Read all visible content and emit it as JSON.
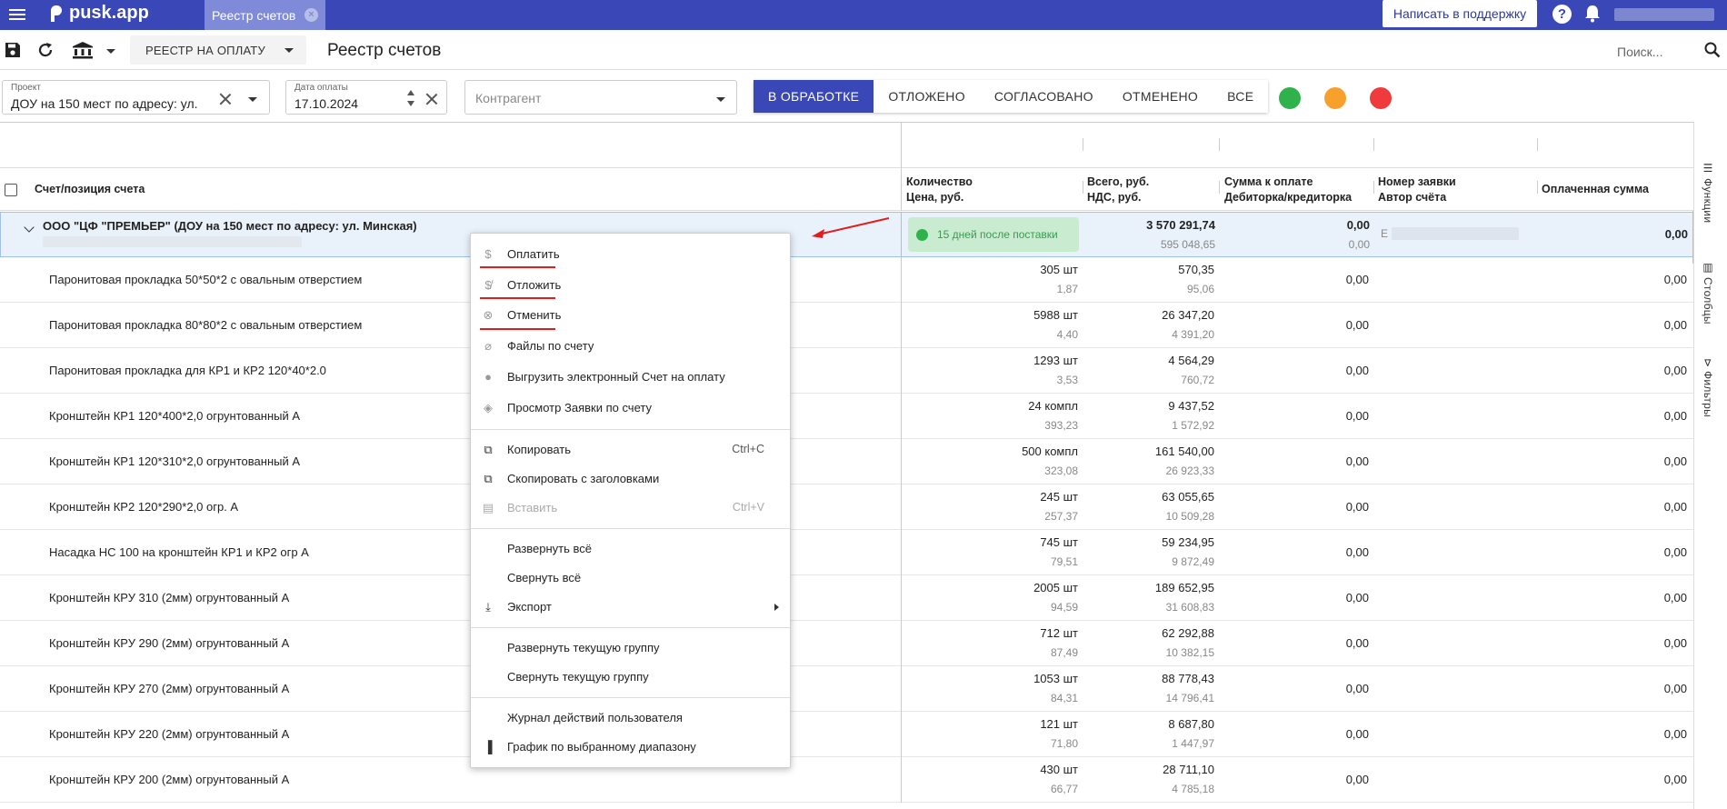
{
  "topbar": {
    "logo": "pusk.app",
    "tab_label": "Реестр счетов",
    "tab_close": "×",
    "support_label": "Написать в поддержку",
    "help_label": "?"
  },
  "toolbar": {
    "registry_label": "РЕЕСТР НА ОПЛАТУ",
    "page_title": "Реестр счетов",
    "search_label": "Поиск..."
  },
  "filters": {
    "project": {
      "label": "Проект",
      "value": "ДОУ на 150 мест по адресу: ул."
    },
    "pay_date": {
      "label": "Дата оплаты",
      "value": "17.10.2024"
    },
    "counterparty": {
      "placeholder": "Контрагент"
    },
    "status_tabs": [
      {
        "label": "В ОБРАБОТКЕ",
        "active": true
      },
      {
        "label": "ОТЛОЖЕНО",
        "active": false
      },
      {
        "label": "СОГЛАСОВАНО",
        "active": false
      },
      {
        "label": "ОТМЕНЕНО",
        "active": false
      },
      {
        "label": "ВСЕ",
        "active": false
      }
    ],
    "status_dots": [
      "#2fb24c",
      "#f7a12c",
      "#ef3b3b"
    ]
  },
  "table": {
    "headers": {
      "item": "Счет/позиция счета",
      "qty": "Количество",
      "price": "Цена, руб.",
      "total": "Всего, руб.",
      "vat": "НДС, руб.",
      "to_pay": "Сумма к оплате",
      "debt": "Дебиторка/кредиторка",
      "req_no": "Номер заявки",
      "author": "Автор счёта",
      "paid": "Оплаченная сумма"
    },
    "group": {
      "title": "ООО \"ЦФ \"ПРЕМЬЕР\" (ДОУ на 150 мест по адресу: ул. Минская)",
      "badge": "15 дней после поставки",
      "total": "3 570 291,74",
      "vat": "595 048,65",
      "to_pay": "0,00",
      "debt": "0,00",
      "req_initial": "Е",
      "paid": "0,00"
    },
    "rows": [
      {
        "name": "Паронитовая прокладка 50*50*2 с овальным отверстием",
        "qty": "305 шт",
        "price": "1,87",
        "total": "570,35",
        "vat": "95,06",
        "to_pay": "0,00",
        "paid": "0,00"
      },
      {
        "name": "Паронитовая прокладка 80*80*2 с овальным отверстием",
        "qty": "5988 шт",
        "price": "4,40",
        "total": "26 347,20",
        "vat": "4 391,20",
        "to_pay": "0,00",
        "paid": "0,00"
      },
      {
        "name": "Паронитовая прокладка для КР1 и КР2 120*40*2.0",
        "qty": "1293 шт",
        "price": "3,53",
        "total": "4 564,29",
        "vat": "760,72",
        "to_pay": "0,00",
        "paid": "0,00"
      },
      {
        "name": "Кронштейн КР1 120*400*2,0 огрунтованный А",
        "qty": "24 компл",
        "price": "393,23",
        "total": "9 437,52",
        "vat": "1 572,92",
        "to_pay": "0,00",
        "paid": "0,00"
      },
      {
        "name": "Кронштейн КР1 120*310*2,0 огрунтованный А",
        "qty": "500 компл",
        "price": "323,08",
        "total": "161 540,00",
        "vat": "26 923,33",
        "to_pay": "0,00",
        "paid": "0,00"
      },
      {
        "name": "Кронштейн КР2 120*290*2,0 огр. А",
        "qty": "245 шт",
        "price": "257,37",
        "total": "63 055,65",
        "vat": "10 509,28",
        "to_pay": "0,00",
        "paid": "0,00"
      },
      {
        "name": "Насадка НС 100 на кронштейн КР1 и КР2 огр А",
        "qty": "745 шт",
        "price": "79,51",
        "total": "59 234,95",
        "vat": "9 872,49",
        "to_pay": "0,00",
        "paid": "0,00"
      },
      {
        "name": "Кронштейн КРУ 310 (2мм) огрунтованный А",
        "qty": "2005 шт",
        "price": "94,59",
        "total": "189 652,95",
        "vat": "31 608,83",
        "to_pay": "0,00",
        "paid": "0,00"
      },
      {
        "name": "Кронштейн КРУ 290 (2мм) огрунтованный А",
        "qty": "712 шт",
        "price": "87,49",
        "total": "62 292,88",
        "vat": "10 382,15",
        "to_pay": "0,00",
        "paid": "0,00"
      },
      {
        "name": "Кронштейн КРУ 270 (2мм) огрунтованный А",
        "qty": "1053 шт",
        "price": "84,31",
        "total": "88 778,43",
        "vat": "14 796,41",
        "to_pay": "0,00",
        "paid": "0,00"
      },
      {
        "name": "Кронштейн КРУ 220 (2мм) огрунтованный А",
        "qty": "121 шт",
        "price": "71,80",
        "total": "8 687,80",
        "vat": "1 447,97",
        "to_pay": "0,00",
        "paid": "0,00"
      },
      {
        "name": "Кронштейн КРУ 200 (2мм) огрунтованный А",
        "qty": "430 шт",
        "price": "66,77",
        "total": "28 711,10",
        "vat": "4 785,18",
        "to_pay": "0,00",
        "paid": "0,00"
      }
    ]
  },
  "sidepanel": {
    "functions": "Функции",
    "columns": "Столбцы",
    "filters": "Фильтры"
  },
  "context_menu": {
    "pay": "Оплатить",
    "postpone": "Отложить",
    "cancel": "Отменить",
    "files": "Файлы по счету",
    "export_invoice": "Выгрузить электронный Счет на оплату",
    "view_request": "Просмотр Заявки по счету",
    "copy": "Копировать",
    "copy_shortcut": "Ctrl+C",
    "copy_headers": "Скопировать с заголовками",
    "paste": "Вставить",
    "paste_shortcut": "Ctrl+V",
    "expand_all": "Развернуть всё",
    "collapse_all": "Свернуть всё",
    "export": "Экспорт",
    "expand_group": "Развернуть текущую группу",
    "collapse_group": "Свернуть текущую группу",
    "user_log": "Журнал действий пользователя",
    "chart_range": "График по выбранному диапазону"
  }
}
